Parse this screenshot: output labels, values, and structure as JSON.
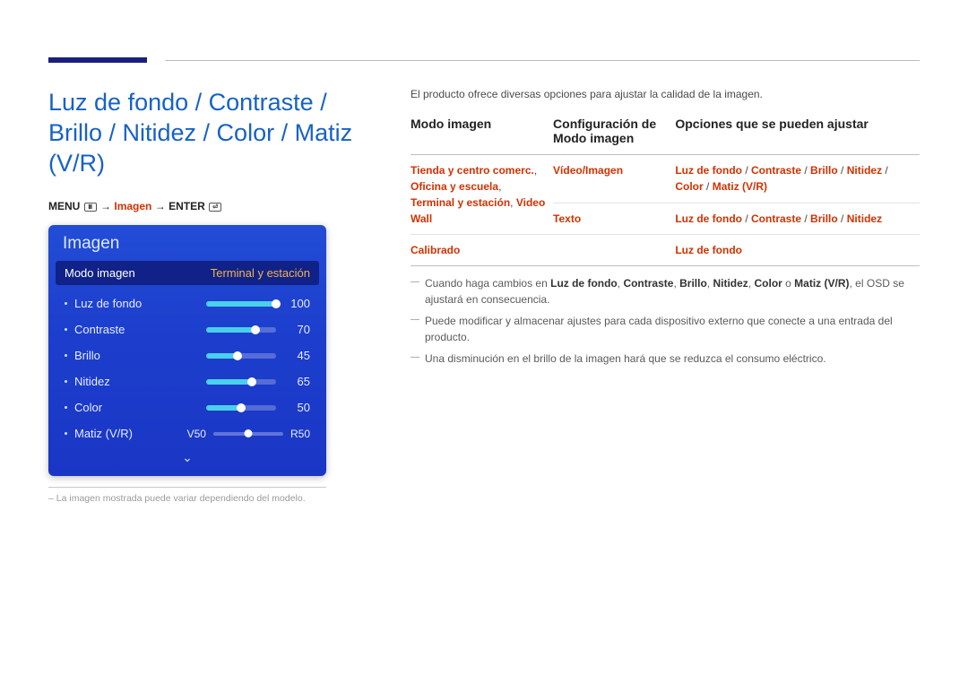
{
  "title": "Luz de fondo / Contraste / Brillo / Nitidez / Color / Matiz (V/R)",
  "breadcrumb": {
    "menu": "MENU",
    "arrow1": " → ",
    "mid": "Imagen",
    "arrow2": " → ",
    "enter": "ENTER"
  },
  "osd": {
    "title": "Imagen",
    "mode_label": "Modo imagen",
    "mode_value": "Terminal y estación",
    "items": [
      {
        "label": "Luz de fondo",
        "value": 100
      },
      {
        "label": "Contraste",
        "value": 70
      },
      {
        "label": "Brillo",
        "value": 45
      },
      {
        "label": "Nitidez",
        "value": 65
      },
      {
        "label": "Color",
        "value": 50
      }
    ],
    "matiz": {
      "label": "Matiz (V/R)",
      "left": "V50",
      "right": "R50"
    }
  },
  "footnote": "La imagen mostrada puede variar dependiendo del modelo.",
  "intro": "El producto ofrece diversas opciones para ajustar la calidad de la imagen.",
  "table": {
    "headers": [
      "Modo imagen",
      "Configuración de Modo imagen",
      "Opciones que se pueden ajustar"
    ],
    "rows": [
      {
        "c1_parts": [
          "Tienda y centro comerc.",
          ", ",
          "Oficina y escuela",
          ", ",
          "Terminal y estación",
          ", ",
          "Video Wall"
        ],
        "c2": "Vídeo/Imagen",
        "c3_parts": [
          "Luz de fondo",
          " / ",
          "Contraste",
          " / ",
          "Brillo",
          " / ",
          "Nitidez",
          " / ",
          "Color",
          " / ",
          "Matiz (V/R)"
        ]
      },
      {
        "c1_parts": [],
        "c2": "Texto",
        "c3_parts": [
          "Luz de fondo",
          " / ",
          "Contraste",
          " / ",
          "Brillo",
          " / ",
          "Nitidez"
        ]
      },
      {
        "c1_parts": [
          "Calibrado"
        ],
        "c2": "",
        "c3_parts": [
          "Luz de fondo"
        ]
      }
    ]
  },
  "notes": [
    {
      "pre": "Cuando haga cambios en ",
      "bold_parts": [
        "Luz de fondo",
        ", ",
        "Contraste",
        ", ",
        "Brillo",
        ", ",
        "Nitidez",
        ", ",
        "Color",
        " o ",
        "Matiz (V/R)"
      ],
      "post": ", el OSD se ajustará en consecuencia."
    },
    {
      "plain": "Puede modificar y almacenar ajustes para cada dispositivo externo que conecte a una entrada del producto."
    },
    {
      "plain": "Una disminución en el brillo de la imagen hará que se reduzca el consumo eléctrico."
    }
  ]
}
